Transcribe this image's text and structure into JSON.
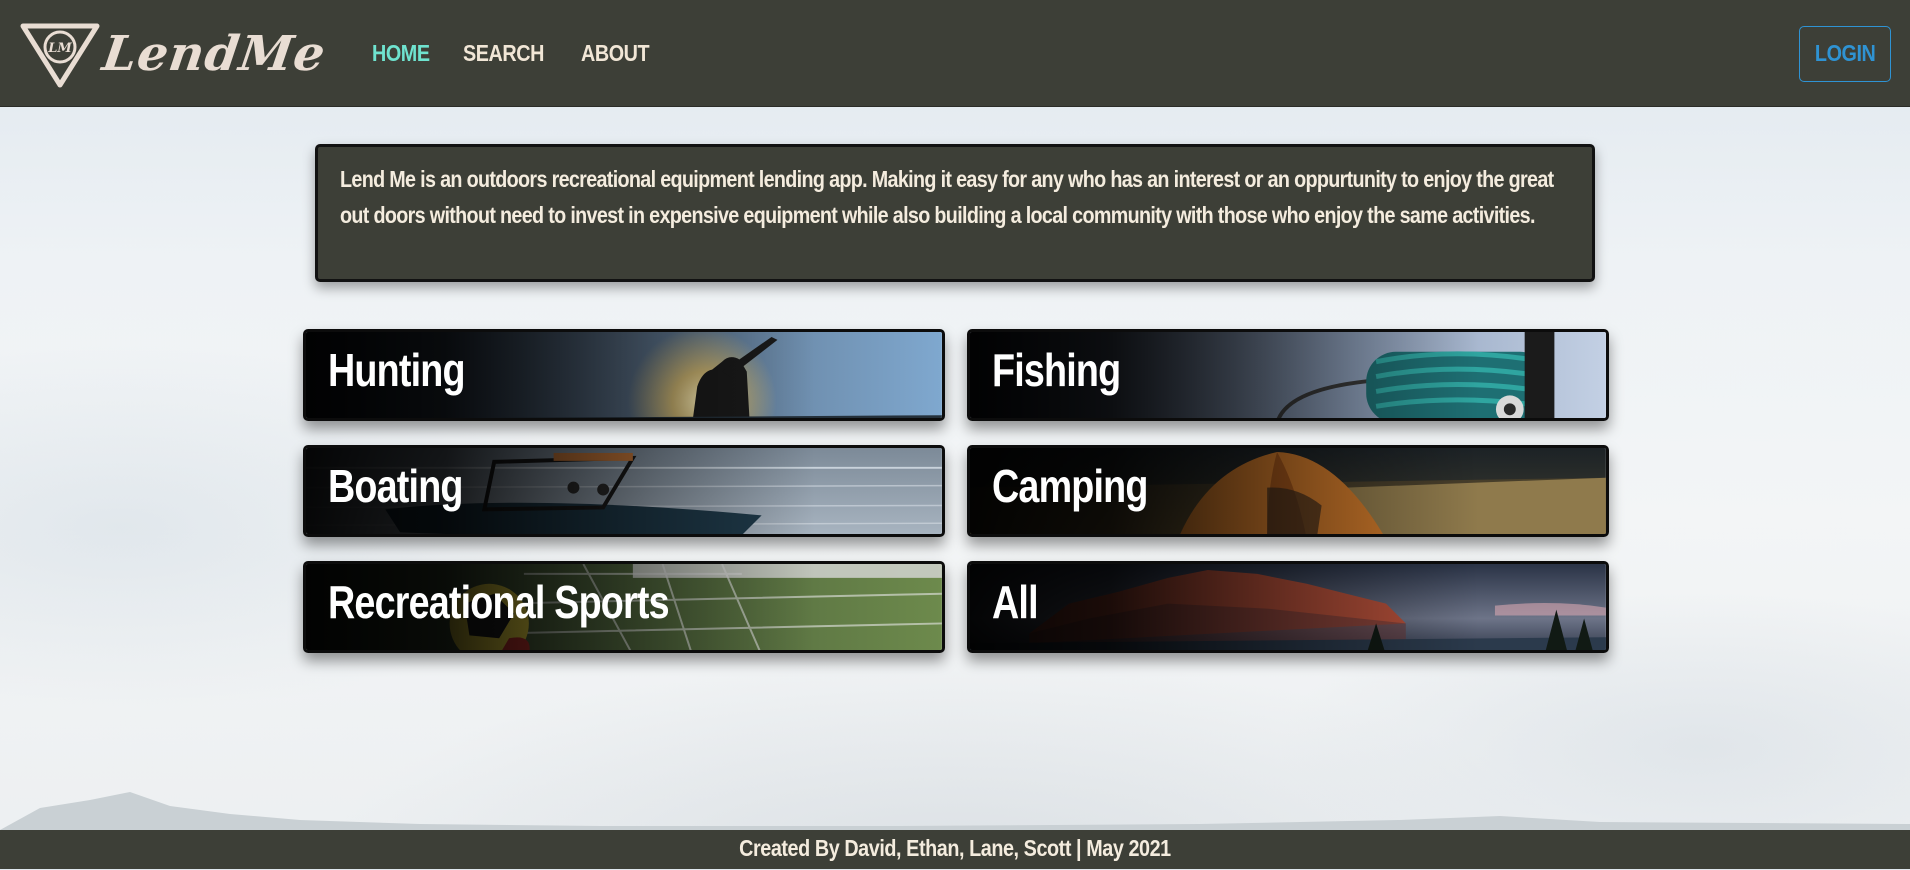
{
  "brand": {
    "logo_text": "LendMe",
    "logo_monogram": "LM"
  },
  "nav": {
    "items": [
      {
        "label": "HOME",
        "active": true
      },
      {
        "label": "SEARCH",
        "active": false
      },
      {
        "label": "ABOUT",
        "active": false
      }
    ],
    "login_label": "LOGIN"
  },
  "intro": {
    "text": "Lend Me is an outdoors recreational equipment lending app. Making it easy for any who has an interest or an oppurtunity to enjoy the great out doors without need to invest in expensive equipment while also building a local community with those who enjoy the same activities."
  },
  "categories": [
    {
      "label": "Hunting",
      "image": "hunter-silhouette-sunset"
    },
    {
      "label": "Fishing",
      "image": "fishing-reel"
    },
    {
      "label": "Boating",
      "image": "wakeboard-boat-on-lake"
    },
    {
      "label": "Camping",
      "image": "orange-tent-in-field"
    },
    {
      "label": "Recreational Sports",
      "image": "soccer-ball-in-net"
    },
    {
      "label": "All",
      "image": "red-mountain-landscape"
    }
  ],
  "footer": {
    "text": "Created By David, Ethan, Lane, Scott | May 2021"
  },
  "colors": {
    "header_bg": "#3d3f37",
    "nav_active": "#6fe3cf",
    "nav_text": "#f1e6d6",
    "login_accent": "#2f93d3",
    "card_text": "#ffffff"
  }
}
